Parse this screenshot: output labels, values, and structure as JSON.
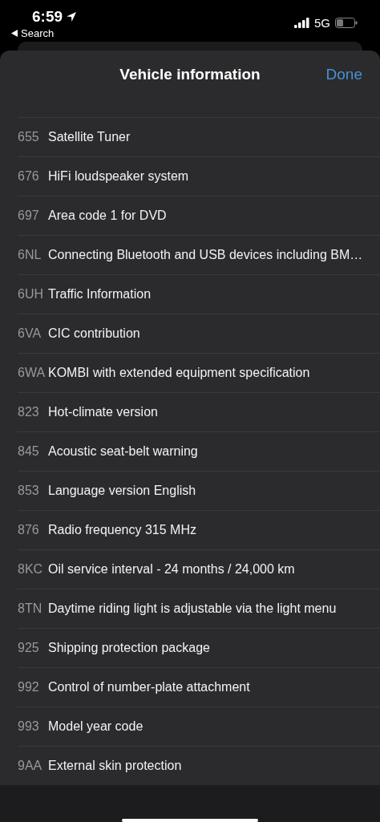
{
  "status_bar": {
    "time": "6:59",
    "back_label": "Search",
    "network": "5G"
  },
  "sheet": {
    "title": "Vehicle information",
    "done_button": "Done"
  },
  "options": [
    {
      "code": "655",
      "name": "Satellite Tuner"
    },
    {
      "code": "676",
      "name": "HiFi loudspeaker system"
    },
    {
      "code": "697",
      "name": "Area code 1 for DVD"
    },
    {
      "code": "6NL",
      "name": "Connecting Bluetooth and USB devices including BM…"
    },
    {
      "code": "6UH",
      "name": "Traffic Information"
    },
    {
      "code": "6VA",
      "name": "CIC contribution"
    },
    {
      "code": "6WA",
      "name": "KOMBI with extended equipment specification"
    },
    {
      "code": "823",
      "name": "Hot-climate version"
    },
    {
      "code": "845",
      "name": "Acoustic seat-belt warning"
    },
    {
      "code": "853",
      "name": "Language version English"
    },
    {
      "code": "876",
      "name": "Radio frequency 315 MHz"
    },
    {
      "code": "8KC",
      "name": "Oil service interval - 24 months / 24,000 km"
    },
    {
      "code": "8TN",
      "name": "Daytime riding light is adjustable via the light menu"
    },
    {
      "code": "925",
      "name": "Shipping protection package"
    },
    {
      "code": "992",
      "name": "Control of number-plate attachment"
    },
    {
      "code": "993",
      "name": "Model year code"
    },
    {
      "code": "9AA",
      "name": "External skin protection"
    }
  ]
}
